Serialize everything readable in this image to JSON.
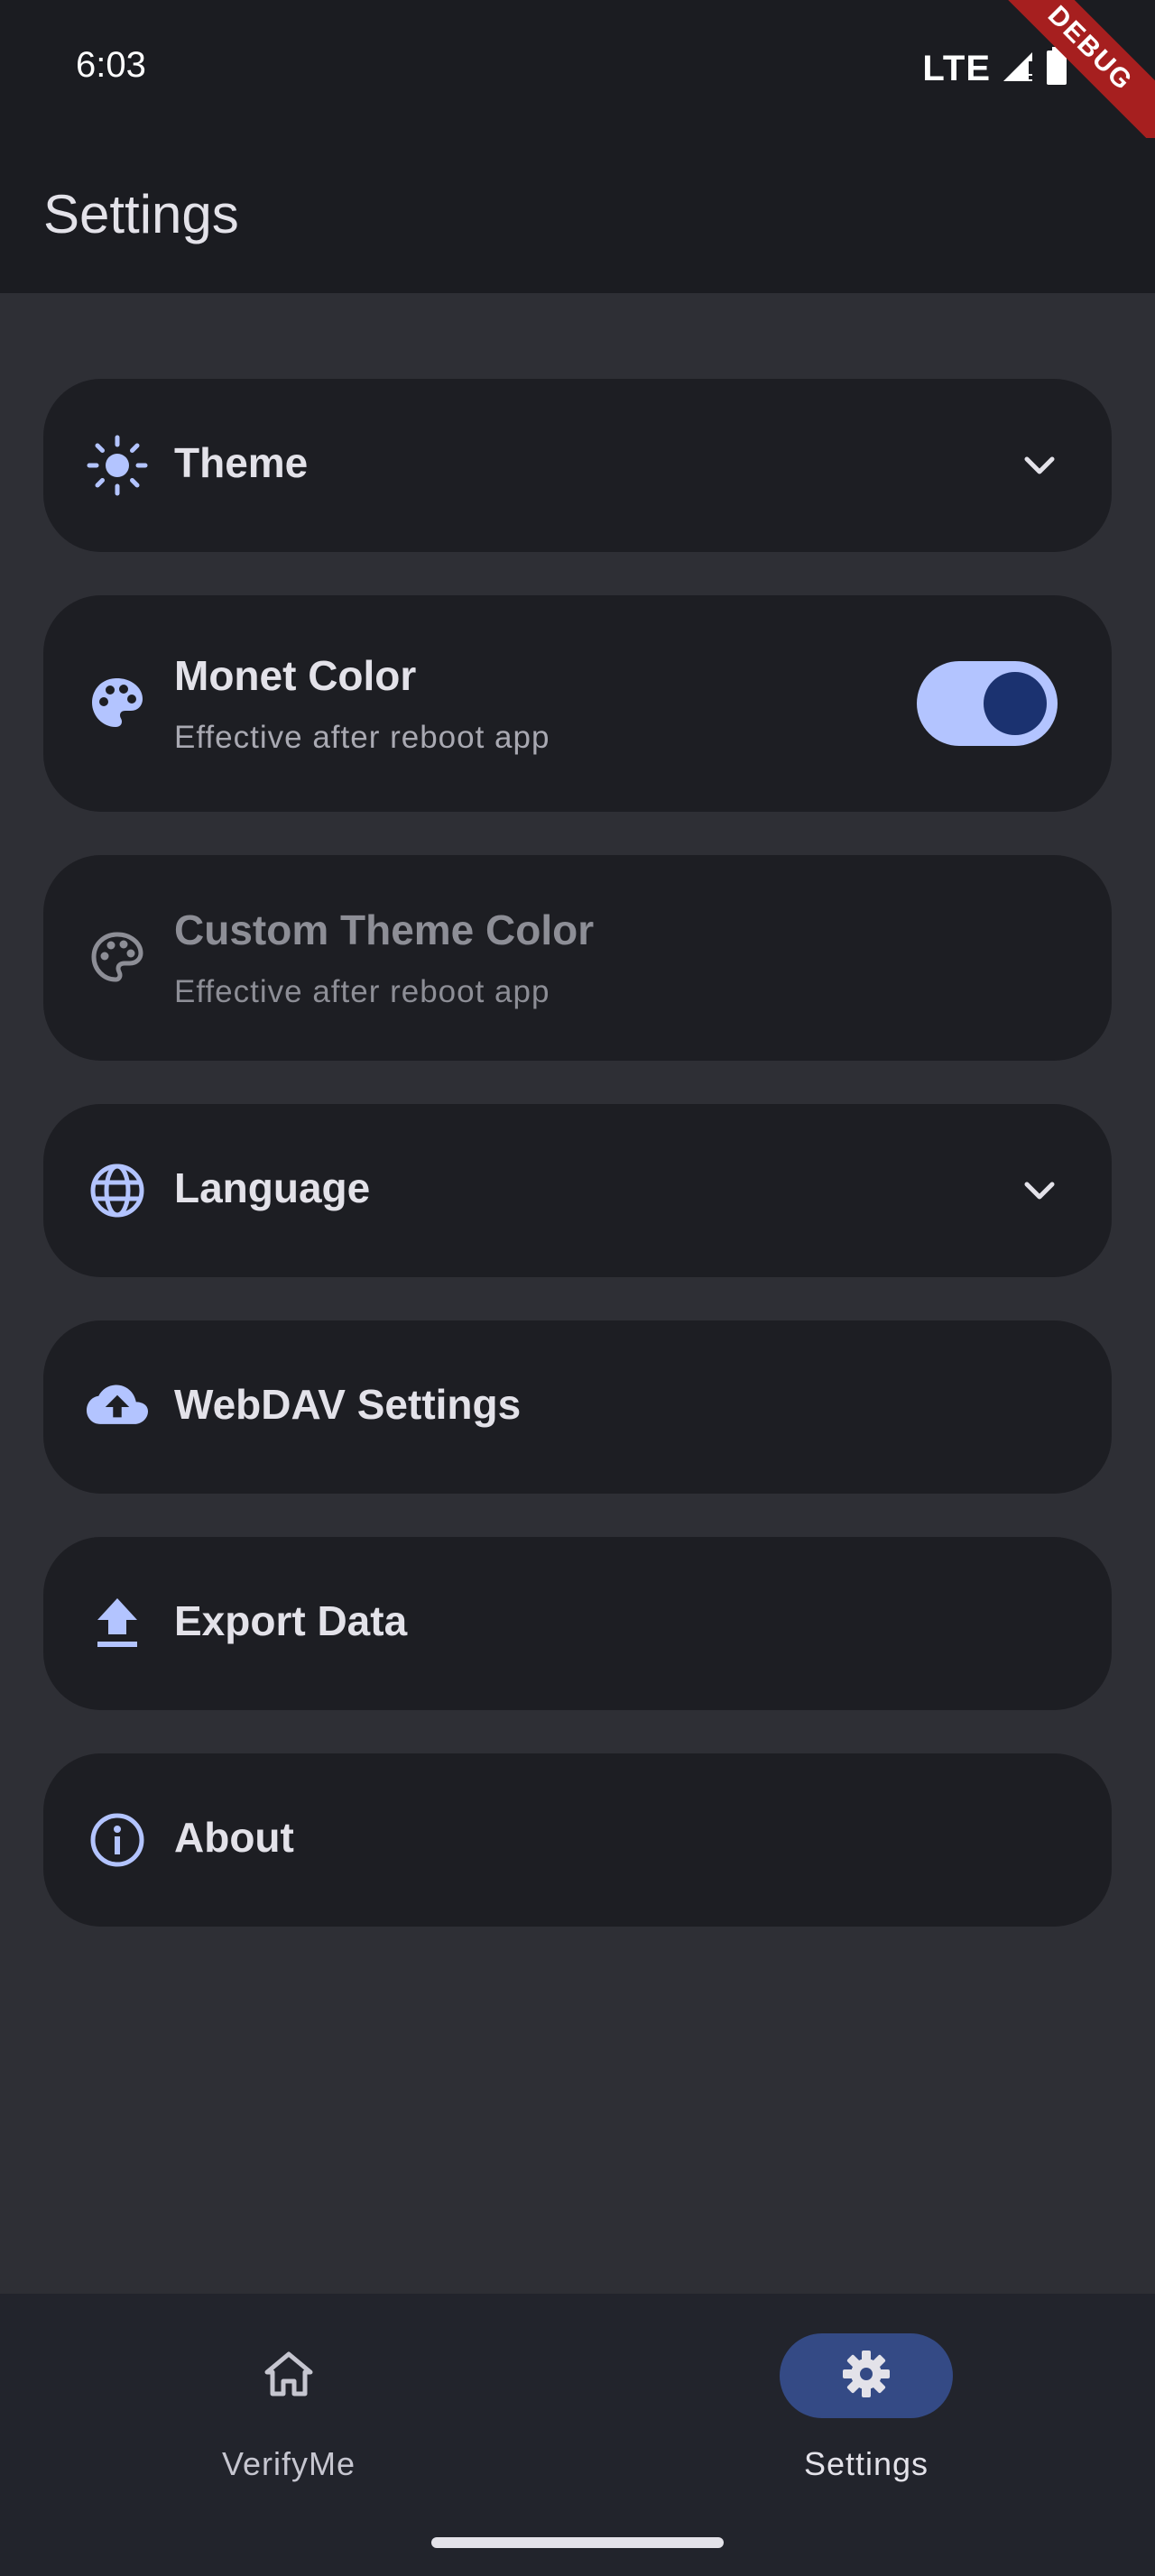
{
  "status_bar": {
    "time": "6:03",
    "network": "LTE"
  },
  "debug_banner": "DEBUG",
  "app_bar": {
    "title": "Settings"
  },
  "settings": {
    "theme": {
      "title": "Theme",
      "icon": "sun-icon",
      "expanded": false
    },
    "monet_color": {
      "title": "Monet Color",
      "subtitle": "Effective after reboot app",
      "icon": "palette-icon",
      "enabled": true
    },
    "custom_theme_color": {
      "title": "Custom Theme Color",
      "subtitle": "Effective after reboot app",
      "icon": "palette-outline-icon",
      "disabled": true
    },
    "language": {
      "title": "Language",
      "icon": "globe-icon",
      "expanded": false
    },
    "webdav": {
      "title": "WebDAV Settings",
      "icon": "cloud-upload-icon"
    },
    "export": {
      "title": "Export Data",
      "icon": "upload-icon"
    },
    "about": {
      "title": "About",
      "icon": "info-icon"
    }
  },
  "bottom_nav": {
    "items": [
      {
        "label": "VerifyMe",
        "icon": "home-icon",
        "active": false
      },
      {
        "label": "Settings",
        "icon": "gear-icon",
        "active": true
      }
    ]
  },
  "colors": {
    "background": "#2e2f35",
    "surface": "#1d1e23",
    "bar": "#1b1c21",
    "accent": "#b3c4ff",
    "accent_dark": "#1b3270",
    "nav_active": "#344a85",
    "text_primary": "#e3e2e9",
    "text_secondary": "#a9a9b2",
    "debug": "#a61f1f"
  }
}
